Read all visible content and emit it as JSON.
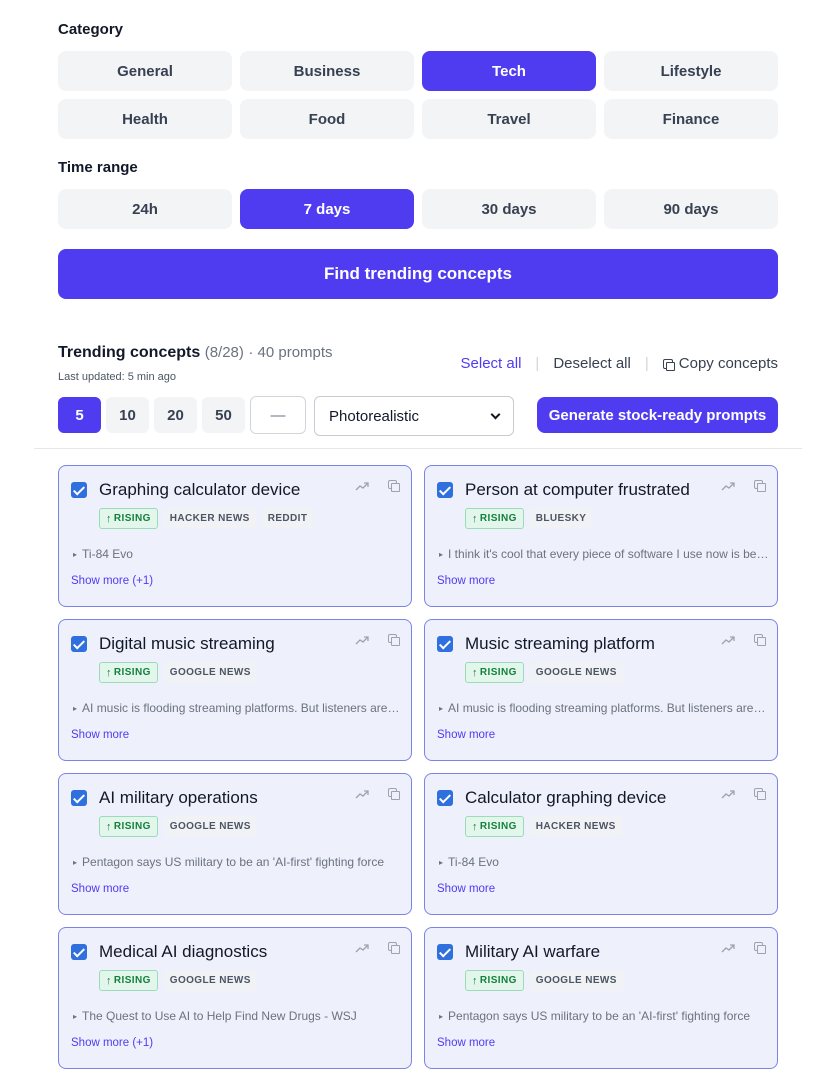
{
  "category": {
    "label": "Category",
    "options": [
      "General",
      "Business",
      "Tech",
      "Lifestyle",
      "Health",
      "Food",
      "Travel",
      "Finance"
    ],
    "selected": "Tech"
  },
  "time_range": {
    "label": "Time range",
    "options": [
      "24h",
      "7 days",
      "30 days",
      "90 days"
    ],
    "selected": "7 days"
  },
  "find_button": "Find trending concepts",
  "trending": {
    "title": "Trending concepts",
    "count": "(8/28)",
    "prompts": "· 40 prompts",
    "updated": "Last updated: 5 min ago",
    "select_all": "Select all",
    "deselect_all": "Deselect all",
    "copy_concepts": "Copy concepts",
    "separator": "|"
  },
  "counts": {
    "options": [
      "5",
      "10",
      "20",
      "50"
    ],
    "selected": "5",
    "custom_placeholder": "—"
  },
  "style_select": {
    "value": "Photorealistic"
  },
  "generate_button": "Generate stock-ready prompts",
  "cards": [
    {
      "title": "Graphing calculator device",
      "checked": true,
      "tags": [
        "RISING",
        "HACKER NEWS",
        "REDDIT"
      ],
      "snippet": "Ti-84 Evo",
      "show_more": "Show more (+1)"
    },
    {
      "title": "Person at computer frustrated",
      "checked": true,
      "tags": [
        "RISING",
        "BLUESKY"
      ],
      "snippet": "I think it's cool that every piece of software I use now is being rewritten",
      "show_more": "Show more"
    },
    {
      "title": "Digital music streaming",
      "checked": true,
      "tags": [
        "RISING",
        "GOOGLE NEWS"
      ],
      "snippet": "AI music is flooding streaming platforms. But listeners aren't buying it",
      "show_more": "Show more"
    },
    {
      "title": "Music streaming platform",
      "checked": true,
      "tags": [
        "RISING",
        "GOOGLE NEWS"
      ],
      "snippet": "AI music is flooding streaming platforms. But listeners aren't buying it",
      "show_more": "Show more"
    },
    {
      "title": "AI military operations",
      "checked": true,
      "tags": [
        "RISING",
        "GOOGLE NEWS"
      ],
      "snippet": "Pentagon says US military to be an 'AI-first' fighting force",
      "show_more": "Show more"
    },
    {
      "title": "Calculator graphing device",
      "checked": true,
      "tags": [
        "RISING",
        "HACKER NEWS"
      ],
      "snippet": "Ti-84 Evo",
      "show_more": "Show more"
    },
    {
      "title": "Medical AI diagnostics",
      "checked": true,
      "tags": [
        "RISING",
        "GOOGLE NEWS"
      ],
      "snippet": "The Quest to Use AI to Help Find New Drugs - WSJ",
      "show_more": "Show more (+1)"
    },
    {
      "title": "Military AI warfare",
      "checked": true,
      "tags": [
        "RISING",
        "GOOGLE NEWS"
      ],
      "snippet": "Pentagon says US military to be an 'AI-first' fighting force",
      "show_more": "Show more"
    }
  ],
  "colors": {
    "accent": "#4f3cf0",
    "card_bg": "#eef0fc",
    "card_border": "#7c83e6",
    "rising": "#15803d"
  }
}
